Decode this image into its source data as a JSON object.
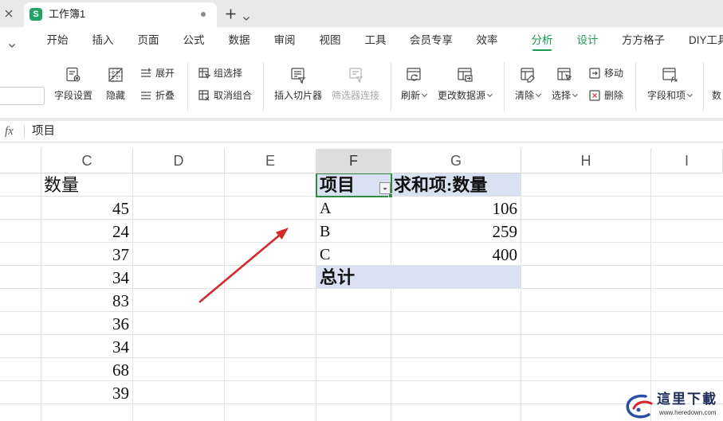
{
  "colors": {
    "accent_green": "#1a9b52",
    "sheet_icon_green": "#21a366",
    "pivot_header_fill": "#d9e1f2",
    "selection_border": "#2e8b3e",
    "annotation_red": "#d8262b",
    "watermark_navy": "#1c2a5a"
  },
  "icons": [
    "close-icon",
    "plus-icon",
    "chevron-down-icon",
    "field-settings-icon",
    "hide-icon",
    "expand-icon",
    "collapse-icon",
    "group-select-icon",
    "ungroup-icon",
    "insert-slicer-icon",
    "filter-connections-icon",
    "refresh-icon",
    "change-data-source-icon",
    "clear-icon",
    "select-icon",
    "move-icon",
    "delete-icon",
    "fields-items-icon",
    "fx-icon"
  ],
  "tabs": [
    {
      "app_letter": "S",
      "title": "工作簿1"
    }
  ],
  "menu": {
    "items": [
      "开始",
      "插入",
      "页面",
      "公式",
      "数据",
      "审阅",
      "视图",
      "工具",
      "会员专享",
      "效率",
      "分析",
      "设计",
      "方方格子",
      "DIY工具"
    ],
    "active_index": 10
  },
  "ribbon": {
    "field_settings": "字段设置",
    "hide": "隐藏",
    "expand": "展开",
    "collapse": "折叠",
    "group_selection": "组选择",
    "ungroup": "取消组合",
    "insert_slicer": "插入切片器",
    "filter_connections": "筛选器连接",
    "refresh": "刷新",
    "change_data_source": "更改数据源",
    "clear": "清除",
    "select": "选择",
    "move": "移动",
    "delete": "删除",
    "fields_items": "字段和项",
    "overflow_label": "数"
  },
  "formula_bar": {
    "fx_label": "fx",
    "value": "项目"
  },
  "sheet": {
    "column_headers": [
      "C",
      "D",
      "E",
      "F",
      "G",
      "H",
      "I"
    ],
    "active_column_index": 3,
    "column_c": {
      "header": "数量",
      "values": [
        45,
        24,
        37,
        34,
        83,
        36,
        34,
        68,
        39
      ]
    }
  },
  "pivot": {
    "headers": [
      "项目",
      "求和项:数量"
    ],
    "rows": [
      {
        "item": "A",
        "sum": 106
      },
      {
        "item": "B",
        "sum": 259
      },
      {
        "item": "C",
        "sum": 400
      }
    ],
    "total_label": "总计"
  },
  "watermark": {
    "name": "這里下載",
    "url": "www.heredown.com"
  }
}
